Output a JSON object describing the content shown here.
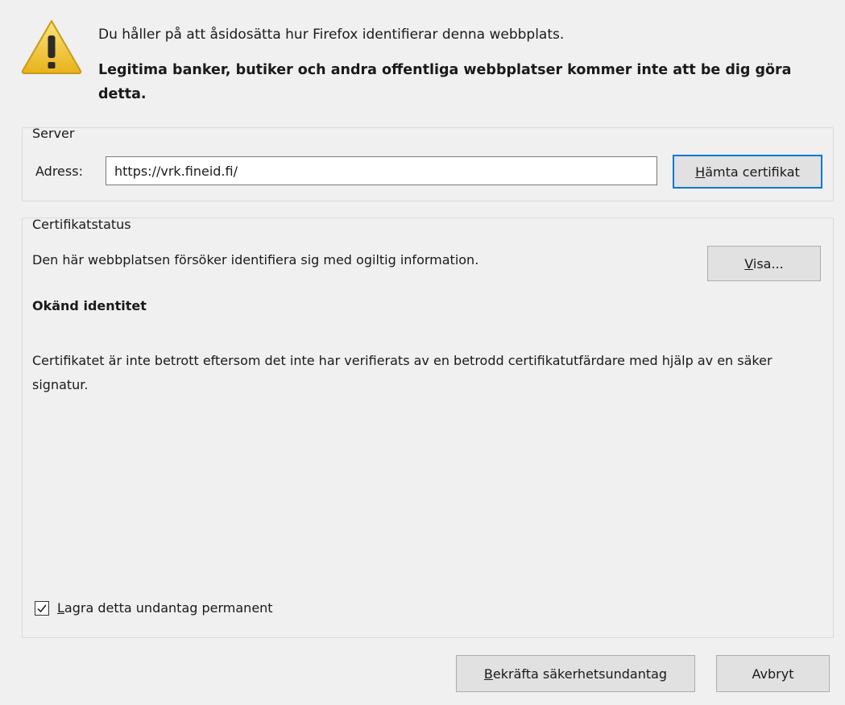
{
  "header": {
    "line1": "Du håller på att åsidosätta hur Firefox identifierar denna webbplats.",
    "line2": "Legitima banker, butiker och andra offentliga webbplatser kommer inte att be dig göra detta.",
    "icon": "warning-icon",
    "icon_color": "#f3c93a"
  },
  "server": {
    "group_label": "Server",
    "address_label": "Adress:",
    "address_value": "https://vrk.fineid.fi/",
    "fetch_button": {
      "mnemonic": "H",
      "rest": "ämta certifikat"
    }
  },
  "status": {
    "group_label": "Certifikatstatus",
    "message": "Den här webbplatsen försöker identifiera sig med ogiltig information.",
    "view_button": {
      "mnemonic": "V",
      "rest": "isa..."
    },
    "identity_heading": "Okänd identitet",
    "identity_detail": "Certifikatet är inte betrott eftersom det inte har verifierats av en betrodd certifikatutfärdare med hjälp av en säker signatur.",
    "permanent": {
      "checked": true,
      "mnemonic": "L",
      "rest": "agra detta undantag permanent"
    }
  },
  "footer": {
    "confirm_button": {
      "mnemonic": "B",
      "rest": "ekräfta säkerhetsundantag"
    },
    "cancel_button": "Avbryt"
  },
  "colors": {
    "dialog_bg": "#f0f0f0",
    "focus_border": "#0078d7"
  }
}
